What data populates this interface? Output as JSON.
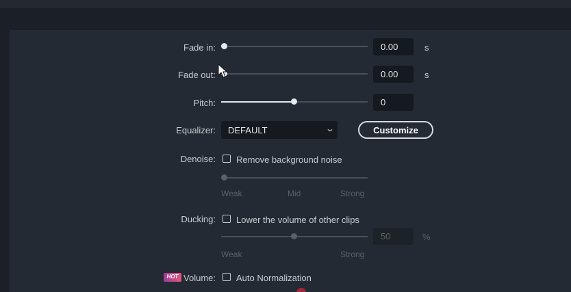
{
  "fade_in": {
    "label": "Fade in:",
    "value": "0.00",
    "unit": "s",
    "level": 0
  },
  "fade_out": {
    "label": "Fade out:",
    "value": "0.00",
    "unit": "s",
    "level": 0
  },
  "pitch": {
    "label": "Pitch:",
    "value": "0",
    "level": 0.5
  },
  "equalizer": {
    "label": "Equalizer:",
    "selected": "DEFAULT",
    "customize_label": "Customize"
  },
  "denoise": {
    "label": "Denoise:",
    "checkbox_label": "Remove background noise",
    "checked": false,
    "ticks": [
      "Weak",
      "Mid",
      "Strong"
    ],
    "level": 0
  },
  "ducking": {
    "label": "Ducking:",
    "checkbox_label": "Lower the volume of other clips",
    "checked": false,
    "value": "50",
    "unit": "%",
    "ticks": [
      "Weak",
      "Strong"
    ],
    "level": 0.5
  },
  "volume": {
    "badge": "HOT",
    "label": "Volume:",
    "checkbox_label": "Auto Normalization",
    "checked": false
  },
  "colors": {
    "panel": "#242a34",
    "accent_hot": "#e2577c",
    "track": "#4a505a",
    "fill": "#e8e9eb"
  },
  "icons": {
    "cursor": "arrow-cursor-icon",
    "dropdown": "chevron-down-icon"
  }
}
